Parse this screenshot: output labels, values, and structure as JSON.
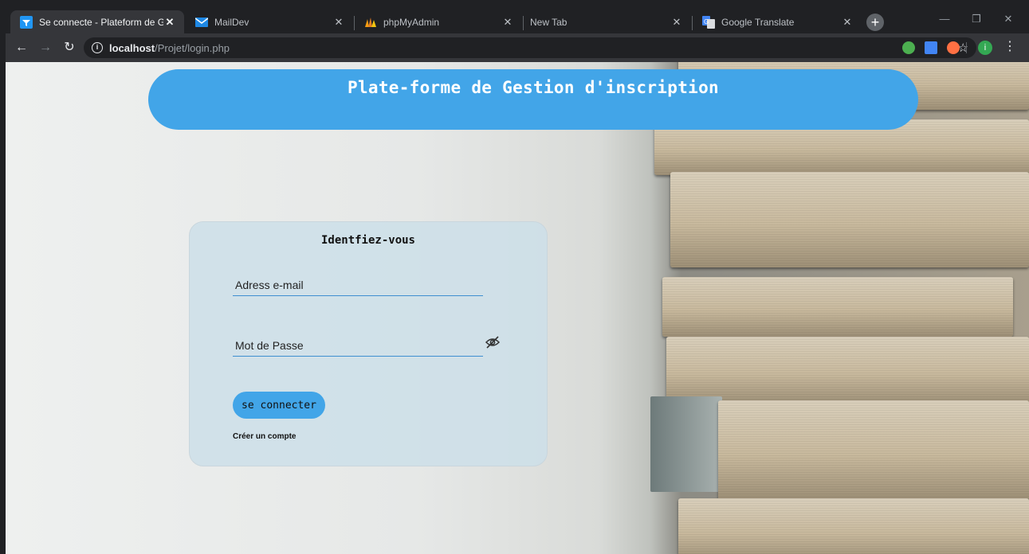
{
  "browser": {
    "tabs": [
      {
        "title": "Se connecte - Plateform de Ge",
        "favicon": "form-icon",
        "active": true
      },
      {
        "title": "MailDev",
        "favicon": "mail-icon",
        "active": false
      },
      {
        "title": "phpMyAdmin",
        "favicon": "phpmyadmin-icon",
        "active": false
      },
      {
        "title": "New Tab",
        "favicon": "",
        "active": false
      },
      {
        "title": "Google Translate",
        "favicon": "translate-icon",
        "active": false
      }
    ],
    "tab_close_glyph": "✕",
    "new_tab_glyph": "+",
    "url_host": "localhost",
    "url_path": "/Projet/login.php",
    "profile_initial": "i",
    "accent_color": "#42a5e8"
  },
  "page": {
    "banner_title": "Plate-forme de Gestion d'inscription",
    "login": {
      "title": "Identfiez-vous",
      "email_placeholder": "Adress e-mail",
      "password_placeholder": "Mot de Passe",
      "submit_label": "se connecter",
      "signup_link": "Créer un compte"
    }
  }
}
